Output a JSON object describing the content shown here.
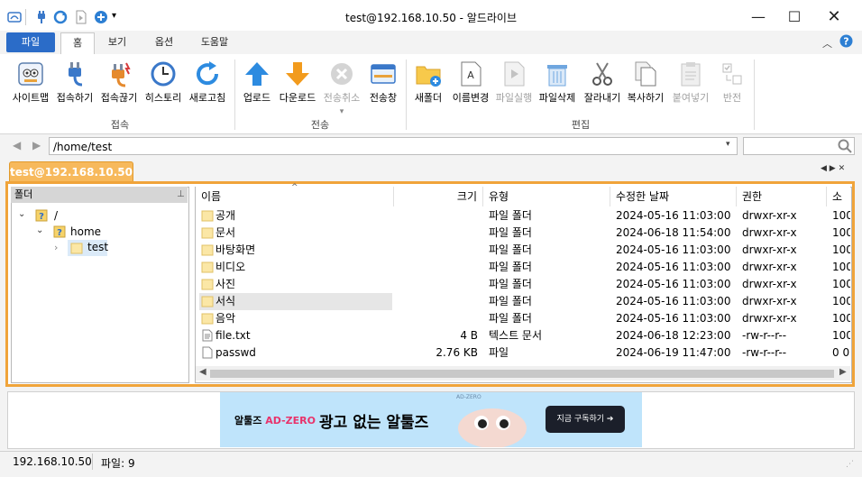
{
  "window": {
    "title": "test@192.168.10.50 - 알드라이브"
  },
  "ribbon_tabs": [
    {
      "label": "파일"
    },
    {
      "label": "홈"
    },
    {
      "label": "보기"
    },
    {
      "label": "옵션"
    },
    {
      "label": "도움말"
    }
  ],
  "ribbon": {
    "buttons": {
      "sitemap": "사이트맵",
      "connect": "접속하기",
      "disconnect": "접속끊기",
      "history": "히스토리",
      "refresh": "새로고침",
      "upload": "업로드",
      "download": "다운로드",
      "cancel_transfer": "전송취소",
      "transfer_window": "전송창",
      "new_folder": "새폴더",
      "rename": "이름변경",
      "run_file": "파일실행",
      "delete_file": "파일삭제",
      "cut": "잘라내기",
      "copy": "복사하기",
      "paste": "붙여넣기",
      "invert": "반전"
    },
    "groups": {
      "connect": "접속",
      "transfer": "전송",
      "edit": "편집"
    }
  },
  "address": {
    "path": "/home/test"
  },
  "session_tab": {
    "label": "test@192.168.10.50"
  },
  "folder_pane": {
    "header": "폴더",
    "tree": [
      {
        "label": "/"
      },
      {
        "label": "home"
      },
      {
        "label": "test"
      }
    ]
  },
  "file_list": {
    "columns": {
      "name": "이름",
      "size": "크기",
      "type": "유형",
      "modified": "수정한 날짜",
      "perm": "권한",
      "owner": "소유"
    },
    "rows": [
      {
        "name": "공개",
        "size": "",
        "type": "파일 폴더",
        "modified": "2024-05-16 11:03:00",
        "perm": "drwxr-xr-x",
        "owner": "100"
      },
      {
        "name": "문서",
        "size": "",
        "type": "파일 폴더",
        "modified": "2024-06-18 11:54:00",
        "perm": "drwxr-xr-x",
        "owner": "100"
      },
      {
        "name": "바탕화면",
        "size": "",
        "type": "파일 폴더",
        "modified": "2024-05-16 11:03:00",
        "perm": "drwxr-xr-x",
        "owner": "100"
      },
      {
        "name": "비디오",
        "size": "",
        "type": "파일 폴더",
        "modified": "2024-05-16 11:03:00",
        "perm": "drwxr-xr-x",
        "owner": "100"
      },
      {
        "name": "사진",
        "size": "",
        "type": "파일 폴더",
        "modified": "2024-05-16 11:03:00",
        "perm": "drwxr-xr-x",
        "owner": "100"
      },
      {
        "name": "서식",
        "size": "",
        "type": "파일 폴더",
        "modified": "2024-05-16 11:03:00",
        "perm": "drwxr-xr-x",
        "owner": "100"
      },
      {
        "name": "음악",
        "size": "",
        "type": "파일 폴더",
        "modified": "2024-05-16 11:03:00",
        "perm": "drwxr-xr-x",
        "owner": "100"
      },
      {
        "name": "file.txt",
        "size": "4 B",
        "type": "텍스트 문서",
        "modified": "2024-06-18 12:23:00",
        "perm": "-rw-r--r--",
        "owner": "100"
      },
      {
        "name": "passwd",
        "size": "2.76 KB",
        "type": "파일",
        "modified": "2024-06-19 11:47:00",
        "perm": "-rw-r--r--",
        "owner": "0 0"
      }
    ]
  },
  "ad": {
    "brand": "알툴즈",
    "product": "AD-ZERO",
    "headline": "광고 없는 알툴즈",
    "cta": "지금 구독하기 ➔",
    "tag": "AD-ZERO"
  },
  "status": {
    "host": "192.168.10.50",
    "files": "파일: 9"
  },
  "colors": {
    "accent": "#2b6cc8",
    "session_orange": "#f0a43a",
    "ad_bg": "#bfe4fb"
  }
}
